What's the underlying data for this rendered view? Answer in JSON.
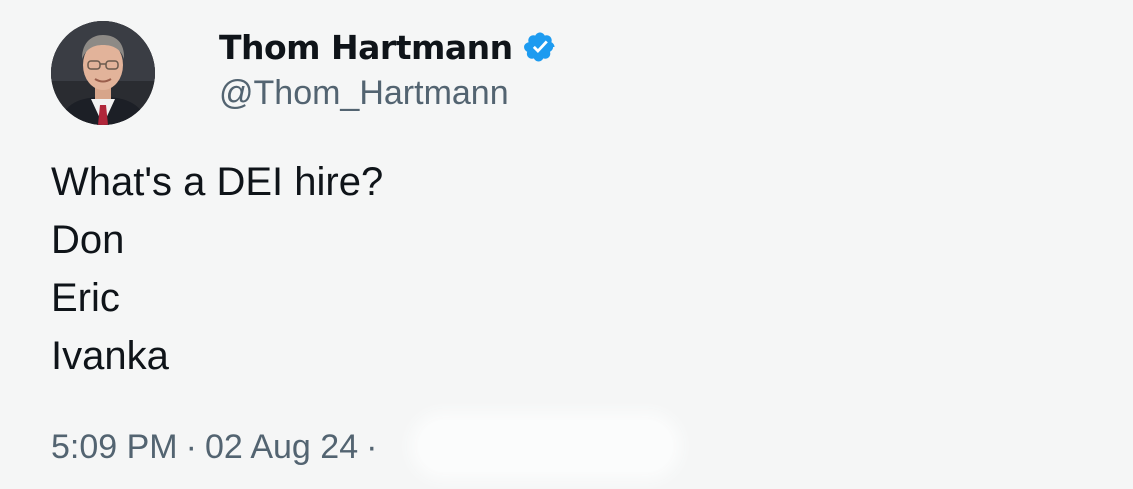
{
  "author": {
    "display_name": "Thom Hartmann",
    "handle": "@Thom_Hartmann",
    "verified_icon": "verified-badge-icon",
    "verified_color": "#1d9bf0"
  },
  "tweet": {
    "lines": [
      "What's a DEI hire?",
      "Don",
      "Eric",
      "Ivanka"
    ]
  },
  "meta": {
    "time": "5:09 PM",
    "separator": "·",
    "date": "02 Aug 24"
  },
  "colors": {
    "background": "#f5f6f6",
    "text_primary": "#0f1419",
    "text_secondary": "#536471"
  }
}
